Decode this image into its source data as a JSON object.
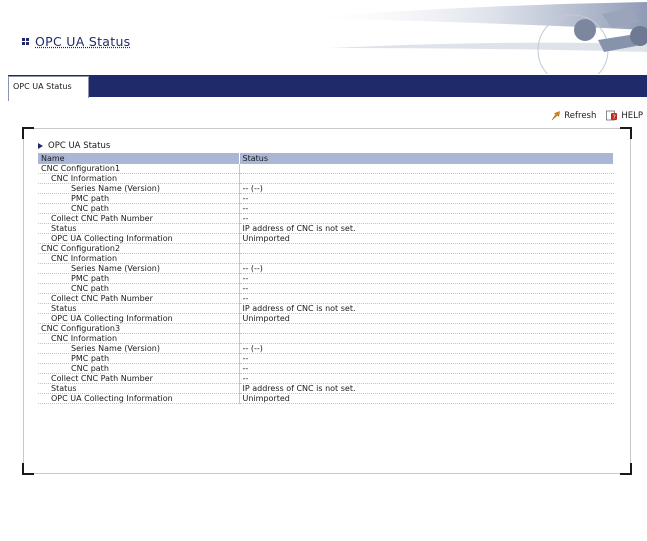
{
  "header": {
    "title": "OPC UA Status"
  },
  "tabs": [
    {
      "label": "OPC UA Status",
      "active": true
    }
  ],
  "toolbar": {
    "refresh_label": "Refresh",
    "help_label": "HELP"
  },
  "panel": {
    "section_title": "OPC UA Status"
  },
  "table": {
    "columns": [
      "Name",
      "Status"
    ],
    "rows": [
      {
        "name": "CNC Configuration1",
        "status": "",
        "level": 1
      },
      {
        "name": "CNC Information",
        "status": "",
        "level": 2
      },
      {
        "name": "Series Name (Version)",
        "status": "-- (--)",
        "level": 4
      },
      {
        "name": "PMC path",
        "status": "--",
        "level": 4
      },
      {
        "name": "CNC path",
        "status": "--",
        "level": 4
      },
      {
        "name": "Collect CNC Path Number",
        "status": "--",
        "level": 2
      },
      {
        "name": "Status",
        "status": "IP address of CNC is not set.",
        "level": 2
      },
      {
        "name": "OPC UA Collecting Information",
        "status": "Unimported",
        "level": 2
      },
      {
        "name": "CNC Configuration2",
        "status": "",
        "level": 1
      },
      {
        "name": "CNC Information",
        "status": "",
        "level": 2
      },
      {
        "name": "Series Name (Version)",
        "status": "-- (--)",
        "level": 4
      },
      {
        "name": "PMC path",
        "status": "--",
        "level": 4
      },
      {
        "name": "CNC path",
        "status": "--",
        "level": 4
      },
      {
        "name": "Collect CNC Path Number",
        "status": "--",
        "level": 2
      },
      {
        "name": "Status",
        "status": "IP address of CNC is not set.",
        "level": 2
      },
      {
        "name": "OPC UA Collecting Information",
        "status": "Unimported",
        "level": 2
      },
      {
        "name": "CNC Configuration3",
        "status": "",
        "level": 1
      },
      {
        "name": "CNC Information",
        "status": "",
        "level": 2
      },
      {
        "name": "Series Name (Version)",
        "status": "-- (--)",
        "level": 4
      },
      {
        "name": "PMC path",
        "status": "--",
        "level": 4
      },
      {
        "name": "CNC path",
        "status": "--",
        "level": 4
      },
      {
        "name": "Collect CNC Path Number",
        "status": "--",
        "level": 2
      },
      {
        "name": "Status",
        "status": "IP address of CNC is not set.",
        "level": 2
      },
      {
        "name": "OPC UA Collecting Information",
        "status": "Unimported",
        "level": 2
      }
    ]
  },
  "icons": {
    "refresh": "refresh-arrow-icon",
    "help": "help-book-icon",
    "section": "triangle-bullet-icon",
    "title": "grid-bullet-icon"
  },
  "colors": {
    "brand_navy": "#1f2a6b",
    "table_header": "#a9b6d4"
  }
}
